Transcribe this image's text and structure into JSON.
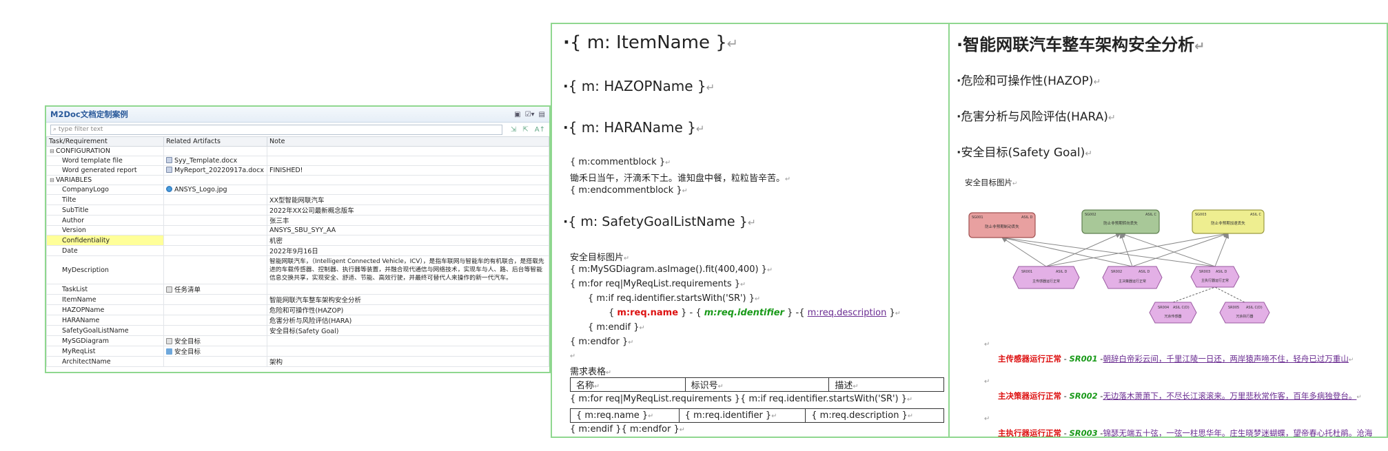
{
  "panel": {
    "title": "M2Doc文档定制案例",
    "filter_placeholder": "type filter text",
    "columns": [
      "Task/Requirement",
      "Related Artifacts",
      "Note"
    ],
    "rows": [
      {
        "level": 1,
        "toggle": "⊟",
        "label": "CONFIGURATION",
        "artifact": "",
        "icon": "",
        "note": ""
      },
      {
        "level": 2,
        "label": "Word template file",
        "artifact": "Syy_Template.docx",
        "icon": "doc",
        "note": ""
      },
      {
        "level": 2,
        "label": "Word generated report",
        "artifact": "MyReport_20220917a.docx",
        "icon": "doc",
        "note": "FINISHED!"
      },
      {
        "level": 1,
        "toggle": "⊟",
        "label": "VARIABLES",
        "artifact": "",
        "icon": "",
        "note": ""
      },
      {
        "level": 2,
        "label": "CompanyLogo",
        "artifact": "ANSYS_Logo.jpg",
        "icon": "globe",
        "note": ""
      },
      {
        "level": 2,
        "label": "Tilte",
        "artifact": "",
        "icon": "",
        "note": "XX型智能网联汽车"
      },
      {
        "level": 2,
        "label": "SubTitle",
        "artifact": "",
        "icon": "",
        "note": "2022年XX公司最新概念版车"
      },
      {
        "level": 2,
        "label": "Author",
        "artifact": "",
        "icon": "",
        "note": "张三丰"
      },
      {
        "level": 2,
        "label": "Version",
        "artifact": "",
        "icon": "",
        "note": "ANSYS_SBU_SYY_AA"
      },
      {
        "level": 2,
        "label": "Confidentiality",
        "artifact": "",
        "icon": "",
        "note": "机密",
        "highlight": true
      },
      {
        "level": 2,
        "label": "Date",
        "artifact": "",
        "icon": "",
        "note": "2022年9月16日"
      },
      {
        "level": 2,
        "label": "MyDescription",
        "artifact": "",
        "icon": "",
        "note": "智能网联汽车，（Intelligent Connected Vehicle，ICV），是指车联网与智能车的有机联合，是搭载先进的车载传感器、控制器、执行器等装置，并融合现代通信与网络技术，实现车与人、路、后台等智能信息交换共享，实现安全、舒适、节能、高效行驶，并最终可替代人来操作的新一代汽车。",
        "wrap": true
      },
      {
        "level": 2,
        "label": "TaskList",
        "artifact": "任务清单",
        "icon": "diag",
        "note": ""
      },
      {
        "level": 2,
        "label": "ItemName",
        "artifact": "",
        "icon": "",
        "note": "智能网联汽车整车架构安全分析"
      },
      {
        "level": 2,
        "label": "HAZOPName",
        "artifact": "",
        "icon": "",
        "note": "危险和可操作性(HAZOP)"
      },
      {
        "level": 2,
        "label": "HARAName",
        "artifact": "",
        "icon": "",
        "note": "危害分析与风险评估(HARA)"
      },
      {
        "level": 2,
        "label": "SafetyGoalListName",
        "artifact": "",
        "icon": "",
        "note": "安全目标(Safety Goal)"
      },
      {
        "level": 2,
        "label": "MySGDiagram",
        "artifact": "安全目标",
        "icon": "diag",
        "note": ""
      },
      {
        "level": 2,
        "label": "MyReqList",
        "artifact": "安全目标",
        "icon": "folder",
        "note": ""
      },
      {
        "level": 2,
        "label": "ArchitectName",
        "artifact": "",
        "icon": "",
        "note": "架构"
      }
    ]
  },
  "template": {
    "item_name": "{  m: ItemName  }",
    "hazop_name": "{  m: HAZOPName  }",
    "hara_name": "{  m: HARAName  }",
    "comment_open": "{  m:commentblock  }",
    "comment_text": "锄禾日当午，汗滴禾下土。谁知盘中餐，粒粒皆辛苦。",
    "comment_close": "{  m:endcommentblock  }",
    "sg_list_name": "{  m: SafetyGoalListName  }",
    "sg_caption": "安全目标图片",
    "as_image": "{  m:MySGDiagram.asImage().fit(400,400)  }",
    "for_req": "{  m:for req|MyReqList.requirements  }",
    "if_sr": "{  m:if req.identifier.startsWith('SR')  }",
    "req_open": "{ ",
    "req_name": "m:req.name",
    "req_mid1": " }  -  { ",
    "req_identifier": "m:req.identifier",
    "req_mid2": " }  -{  ",
    "req_description": "m:req.description",
    "req_close": "  }",
    "endif": "{  m:endif  }",
    "endfor": "{  m:endfor  }",
    "table_caption": "需求表格",
    "table_headers": [
      "名称",
      "标识号",
      "描述"
    ],
    "table_loop": "{  m:for req|MyReqList.requirements  }{  m:if req.identifier.startsWith('SR')  }",
    "table_cells": [
      "{  m:req.name  }",
      "{  m:req.identifier  }",
      "{  m:req.description  }"
    ],
    "table_end": "{  m:endif  }{  m:endfor  }"
  },
  "output": {
    "item_title": "智能网联汽车整车架构安全分析",
    "hazop": "危险和可操作性(HAZOP)",
    "hara": "危害分析与风险评估(HARA)",
    "safety_goal": "安全目标(Safety Goal)",
    "caption": "安全目标图片",
    "diagram": {
      "goals": [
        {
          "id": "SG001",
          "asil": "ASIL D",
          "label": "防止非预期制动丢失",
          "color": "#e8a0a0",
          "stroke": "#a05050"
        },
        {
          "id": "SG002",
          "asil": "ASIL C",
          "label": "防止非预期转向丢失",
          "color": "#a8c898",
          "stroke": "#5f7f50"
        },
        {
          "id": "SG003",
          "asil": "ASIL C",
          "label": "防止非预期加速丢失",
          "color": "#eeee90",
          "stroke": "#9a9a40"
        }
      ],
      "reqs": [
        {
          "id": "SR001",
          "asil": "ASIL D",
          "label": "主传感器运行正常"
        },
        {
          "id": "SR002",
          "asil": "ASIL D",
          "label": "主决策器运行正常"
        },
        {
          "id": "SR003",
          "asil": "ASIL D",
          "label": "主执行器运行正常"
        },
        {
          "id": "SR004",
          "asil": "ASIL C(D)",
          "label": "冗余传感器"
        },
        {
          "id": "SR005",
          "asil": "ASIL C(D)",
          "label": "冗余执行器"
        }
      ]
    },
    "sr_items": [
      {
        "name": "主传感器运行正常",
        "id": "SR001",
        "desc": "朝辞白帝彩云间，千里江陵一日还，两岸猿声啼不住，轻舟已过万重山"
      },
      {
        "name": "主决策器运行正常",
        "id": "SR002",
        "desc": "无边落木萧萧下，不尽长江滚滚来。万里悲秋常作客，百年多病独登台。"
      },
      {
        "name": "主执行器运行正常",
        "id": "SR003",
        "desc": "锦瑟无端五十弦，一弦一柱思华年。庄生晓梦迷蝴蝶，望帝春心托杜鹃。沧海月明珠有泪，蓝田日暖玉生烟。"
      }
    ]
  }
}
